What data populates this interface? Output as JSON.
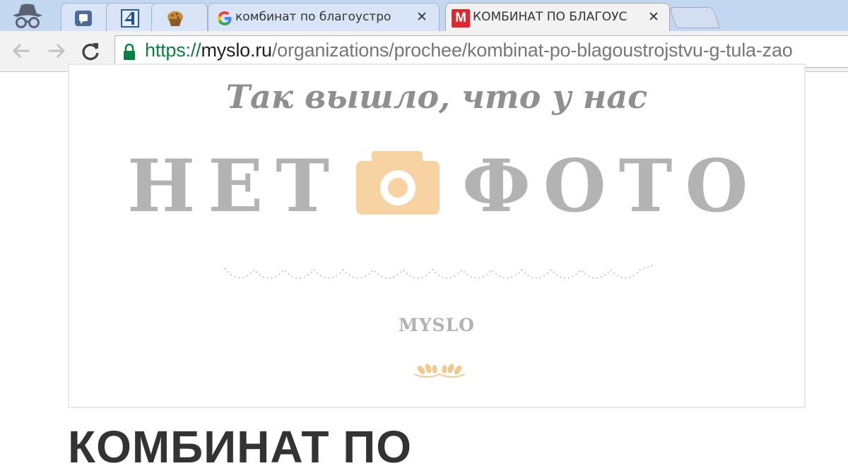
{
  "browser": {
    "tabs": [
      {
        "label": "",
        "icon": "chat-app-icon"
      },
      {
        "label": "",
        "icon": "channel-4-icon"
      },
      {
        "label": "",
        "icon": "muffin-icon"
      },
      {
        "label": "комбинат по благоустро",
        "icon": "google-icon"
      },
      {
        "label": "КОМБИНАТ ПО БЛАГОУС",
        "icon": "myslo-icon",
        "active": true
      }
    ],
    "myslo_favicon_letter": "M",
    "address": {
      "scheme": "https://",
      "host": "myslo.ru",
      "path": "/organizations/prochee/kombinat-po-blagoustrojstvu-g-tula-zao"
    }
  },
  "placeholder": {
    "slogan": "Так вышло, что у нас",
    "word_left": "НЕТ",
    "word_right": "ФОТО",
    "brand": "MYSLO",
    "accent_color": "#f7d3a3"
  },
  "page": {
    "heading": "КОМБИНАТ ПО"
  }
}
